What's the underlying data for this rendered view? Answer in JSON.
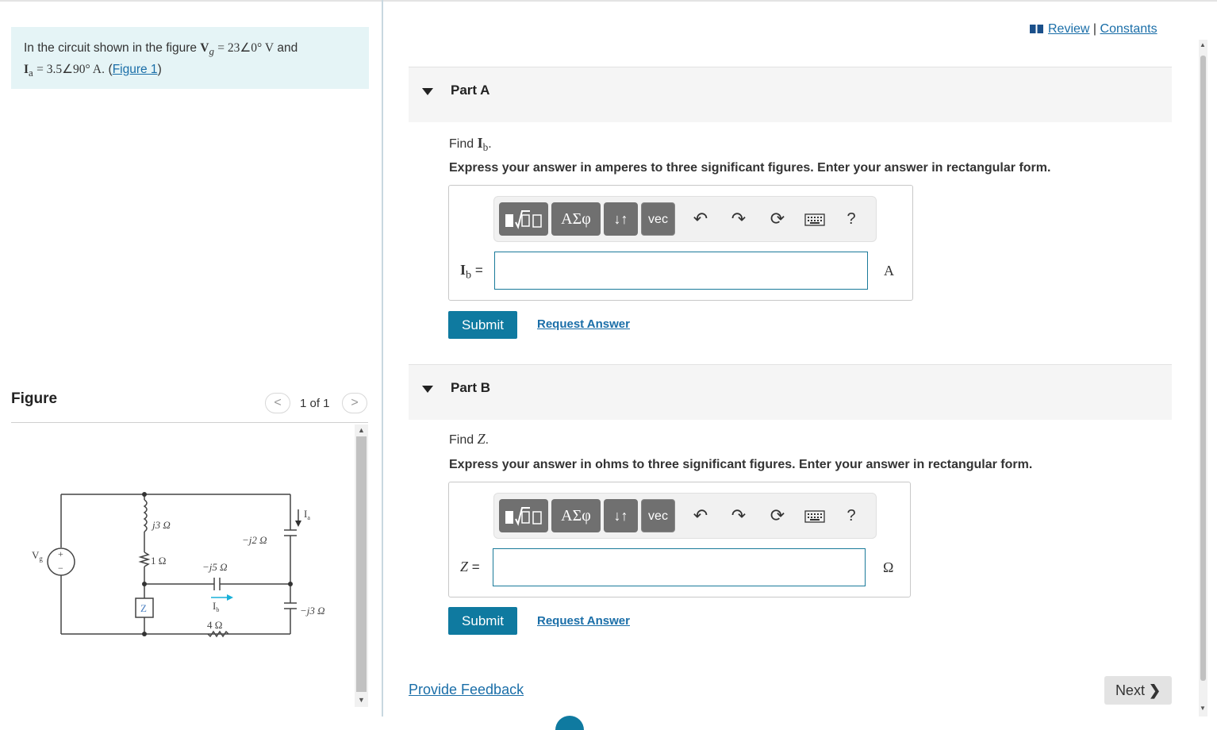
{
  "problem": {
    "prefix": "In the circuit shown in the figure",
    "vg_symbol": "V",
    "vg_subscript": "g",
    "vg_value": "= 23∠0° V",
    "conjunction": "and",
    "ia_symbol": "I",
    "ia_subscript": "a",
    "ia_value": "= 3.5∠90° A",
    "figure_link": "Figure 1"
  },
  "figure_panel": {
    "heading": "Figure",
    "pager": "1 of 1",
    "prev_glyph": "<",
    "next_glyph": ">"
  },
  "circuit_labels": {
    "vg": "V",
    "vg_sub": "g",
    "plus": "+",
    "minus": "−",
    "j3": "j3 Ω",
    "r1": "1 Ω",
    "mj5": "−j5 Ω",
    "mj2": "−j2 Ω",
    "mj3": "−j3 Ω",
    "r4": "4 Ω",
    "z": "Z",
    "ia": "I",
    "ia_sub": "a",
    "ib": "I",
    "ib_sub": "b"
  },
  "links": {
    "review": "Review",
    "separator": "|",
    "constants": "Constants"
  },
  "parts": [
    {
      "title": "Part A",
      "find_prefix": "Find",
      "find_symbol": "I",
      "find_sub": "b",
      "instruction": "Express your answer in amperes to three significant figures. Enter your answer in rectangular form.",
      "var_symbol": "I",
      "var_sub": "b",
      "unit": "A",
      "input_value": "",
      "submit": "Submit",
      "request": "Request Answer"
    },
    {
      "title": "Part B",
      "find_prefix": "Find",
      "find_symbol": "Z",
      "find_sub": "",
      "instruction": "Express your answer in ohms to three significant figures. Enter your answer in rectangular form.",
      "var_symbol": "Z",
      "var_sub": "",
      "unit": "Ω",
      "input_value": "",
      "submit": "Submit",
      "request": "Request Answer"
    }
  ],
  "toolbar": {
    "greek": "ΑΣφ",
    "arrows": "↓↑",
    "vec": "vec",
    "help": "?",
    "icons": [
      "templates-icon",
      "greek-icon",
      "subscript-icon",
      "vector-icon",
      "undo-icon",
      "redo-icon",
      "reset-icon",
      "keyboard-icon",
      "help-icon"
    ]
  },
  "footer": {
    "feedback": "Provide Feedback",
    "next": "Next"
  },
  "colors": {
    "accent": "#0f7aa0",
    "link": "#1a6ea8",
    "problem_bg": "#e5f4f6",
    "toolbar_btn": "#707070"
  }
}
